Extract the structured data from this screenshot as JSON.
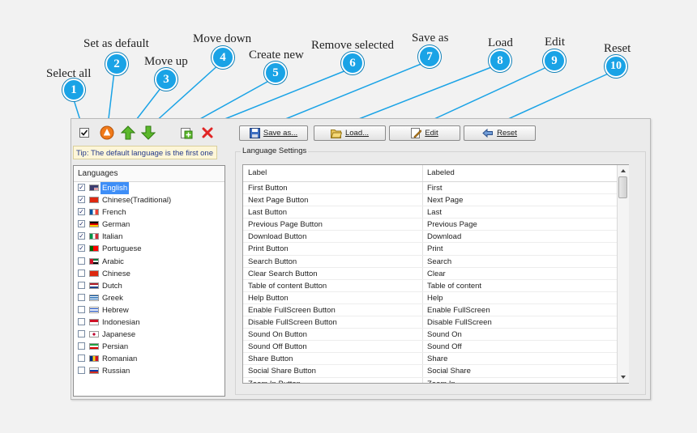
{
  "callouts": [
    {
      "num": "1",
      "label": "Select all"
    },
    {
      "num": "2",
      "label": "Set as default"
    },
    {
      "num": "3",
      "label": "Move up"
    },
    {
      "num": "4",
      "label": "Move down"
    },
    {
      "num": "5",
      "label": "Create new"
    },
    {
      "num": "6",
      "label": "Remove selected"
    },
    {
      "num": "7",
      "label": "Save as"
    },
    {
      "num": "8",
      "label": "Load"
    },
    {
      "num": "9",
      "label": "Edit"
    },
    {
      "num": "10",
      "label": "Reset"
    }
  ],
  "toolbar": {
    "icons": [
      "select-all-checkbox-icon",
      "set-default-icon",
      "move-up-arrow-icon",
      "move-down-arrow-icon",
      "create-new-icon",
      "remove-x-icon"
    ],
    "tip": "Tip: The default language is the first one"
  },
  "languages": {
    "header": "Languages",
    "items": [
      {
        "name": "English",
        "checked": true,
        "selected": true
      },
      {
        "name": "Chinese(Traditional)",
        "checked": true
      },
      {
        "name": "French",
        "checked": true
      },
      {
        "name": "German",
        "checked": true
      },
      {
        "name": "Italian",
        "checked": true
      },
      {
        "name": "Portuguese",
        "checked": true
      },
      {
        "name": "Arabic",
        "checked": false
      },
      {
        "name": "Chinese",
        "checked": false
      },
      {
        "name": "Dutch",
        "checked": false
      },
      {
        "name": "Greek",
        "checked": false
      },
      {
        "name": "Hebrew",
        "checked": false
      },
      {
        "name": "Indonesian",
        "checked": false
      },
      {
        "name": "Japanese",
        "checked": false
      },
      {
        "name": "Persian",
        "checked": false
      },
      {
        "name": "Romanian",
        "checked": false
      },
      {
        "name": "Russian",
        "checked": false
      }
    ]
  },
  "buttons": {
    "save_as": "Save as...",
    "load": "Load...",
    "edit": "Edit",
    "reset": "Reset"
  },
  "settings": {
    "title": "Language Settings",
    "columns": [
      "Label",
      "Labeled"
    ],
    "rows": [
      [
        "First Button",
        "First"
      ],
      [
        "Next Page Button",
        "Next Page"
      ],
      [
        "Last Button",
        "Last"
      ],
      [
        "Previous Page Button",
        "Previous Page"
      ],
      [
        "Download Button",
        "Download"
      ],
      [
        "Print Button",
        "Print"
      ],
      [
        "Search Button",
        "Search"
      ],
      [
        "Clear Search Button",
        "Clear"
      ],
      [
        "Table of content Button",
        "Table of content"
      ],
      [
        "Help Button",
        "Help"
      ],
      [
        "Enable FullScreen Button",
        "Enable FullScreen"
      ],
      [
        "Disable FullScreen Button",
        "Disable FullScreen"
      ],
      [
        "Sound On Button",
        "Sound On"
      ],
      [
        "Sound Off Button",
        "Sound Off"
      ],
      [
        "Share Button",
        "Share"
      ],
      [
        "Social Share Button",
        "Social Share"
      ],
      [
        "Zoom In Button",
        "Zoom In"
      ]
    ]
  },
  "colors": {
    "badge": "#1aa3e6",
    "selection": "#3e8ef7"
  }
}
